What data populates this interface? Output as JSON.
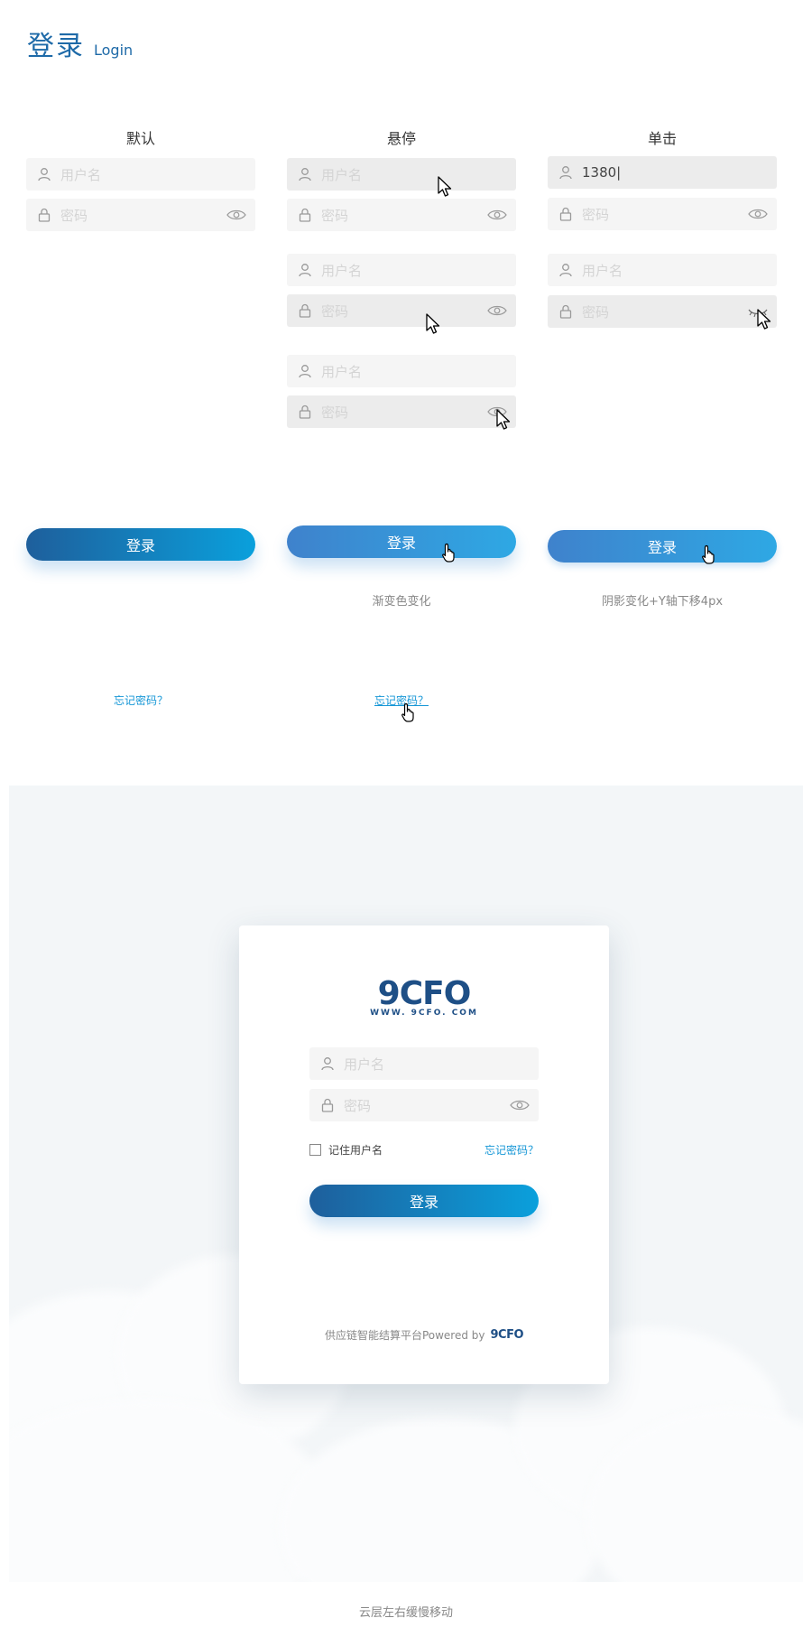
{
  "header": {
    "title_zh": "登录",
    "title_en": "Login"
  },
  "columns": [
    {
      "heading": "默认",
      "note": "",
      "link": "忘记密码？"
    },
    {
      "heading": "悬停",
      "note": "渐变色变化",
      "link": "忘记密码？"
    },
    {
      "heading": "单击",
      "note": "阴影变化+Y轴下移4px",
      "link": ""
    }
  ],
  "fields": {
    "username_placeholder": "用户名",
    "password_placeholder": "密码",
    "typed_value": "1380|"
  },
  "login_button": "登录",
  "card": {
    "logo_text": "9CFO",
    "logo_sub": "WWW. 9CFO. COM",
    "remember_label": "记住用户名",
    "forgot_link": "忘记密码？",
    "footer_text": "供应链智能结算平台Powered by",
    "footer_logo": "9CFO"
  },
  "bottom_caption": "云层左右缓慢移动",
  "colors": {
    "brand": "#1e6aa8",
    "link": "#1496d6",
    "gradient_start": "#1e5f9c",
    "gradient_end": "#0aa0dc"
  }
}
